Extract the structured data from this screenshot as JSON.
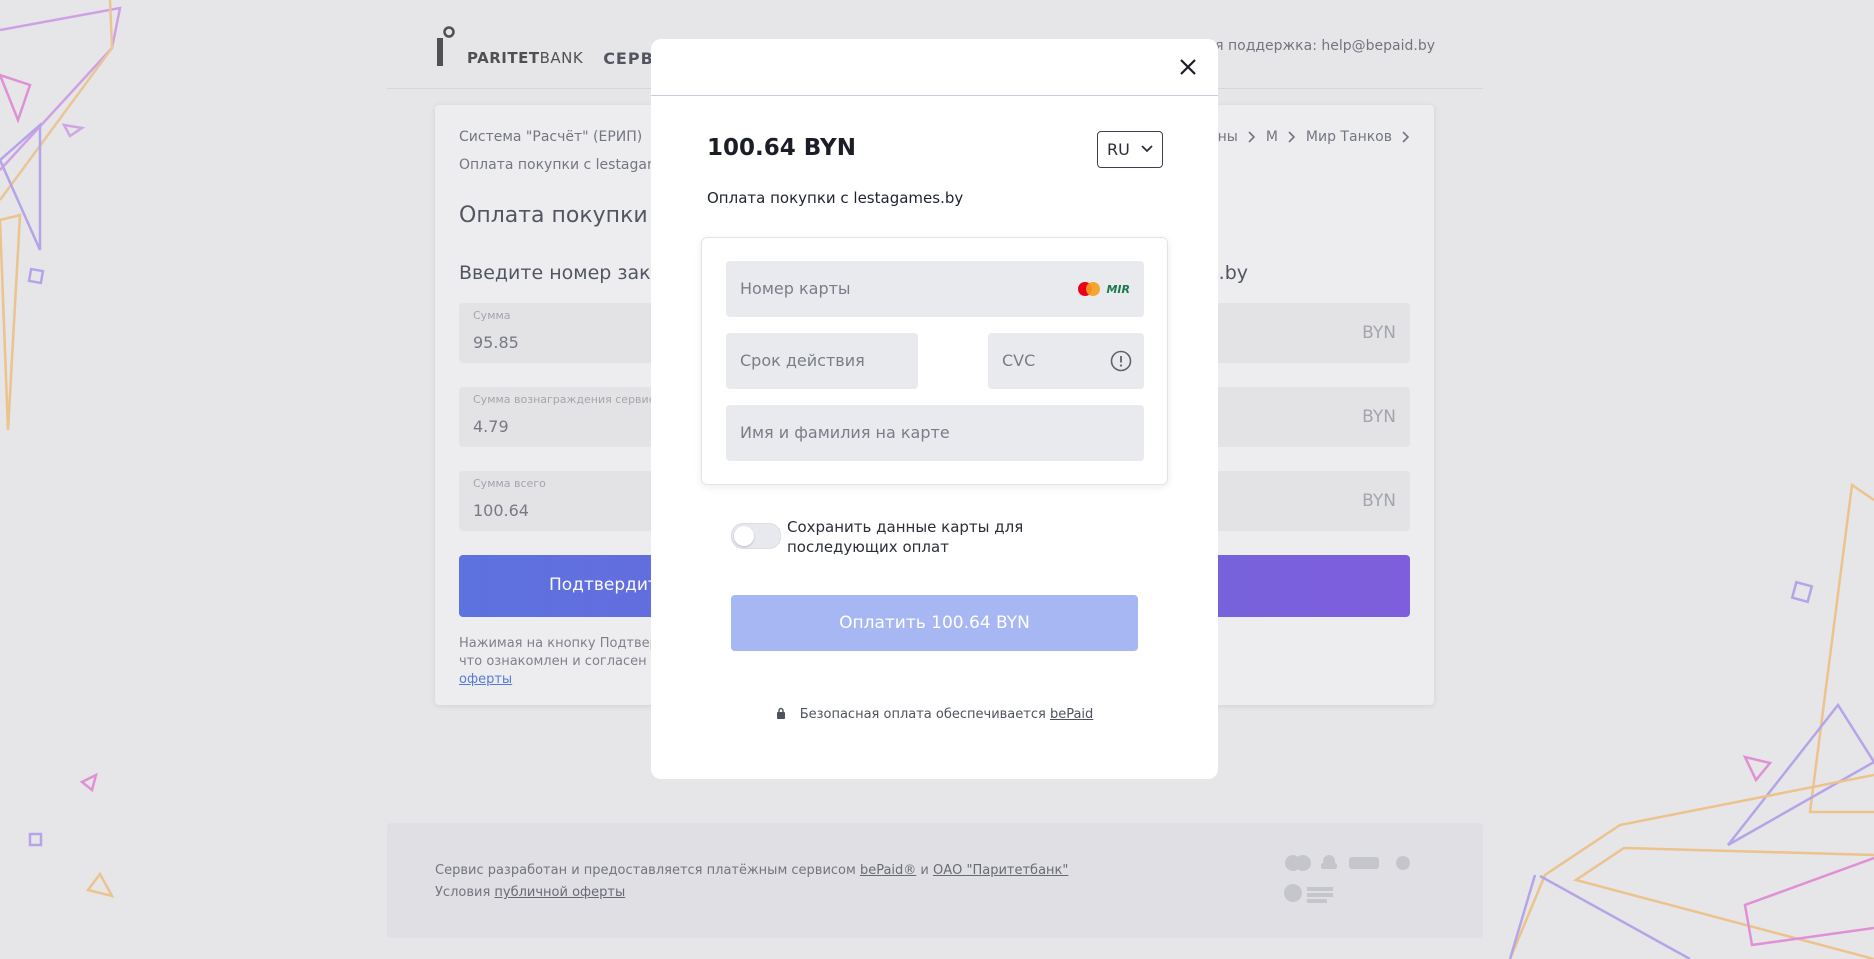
{
  "header": {
    "bank_name_bold": "PARITET",
    "bank_name_thin": "BANK",
    "service": "СЕРВИС С",
    "support": "чная поддержка: help@bepaid.by"
  },
  "breadcrumbs": {
    "left": "Система \"Расчёт\" (ЕРИП)",
    "right": [
      "ены",
      "М",
      "Мир Танков"
    ],
    "second_line": "Оплата покупки с lestagames."
  },
  "page": {
    "title": "Оплата покупки с",
    "subtitle_left": "Введите номер заказ",
    "subtitle_right": "s.by",
    "fields": [
      {
        "label": "Сумма",
        "value": "95.85",
        "currency": "BYN"
      },
      {
        "label": "Сумма вознаграждения сервиса",
        "value": "4.79",
        "currency": "BYN"
      },
      {
        "label": "Сумма всего",
        "value": "100.64",
        "currency": "BYN"
      }
    ],
    "confirm_label": "Подтвердит",
    "terms_line1": "Нажимая на кнопку Подтверд",
    "terms_line2": "что ознакомлен и согласен с",
    "terms_link": "оферты"
  },
  "footer": {
    "line1_text": "Сервис разработан и предоставляется платёжным сервисом ",
    "line1_link1": "bePaid®",
    "line1_and": " и ",
    "line1_link2": "ОАО \"Паритетбанк\"",
    "line2_text": "Условия ",
    "line2_link": "публичной оферты"
  },
  "modal": {
    "amount": "100.64 BYN",
    "language": "RU",
    "description": "Оплата покупки с lestagames.by",
    "card_number_placeholder": "Номер карты",
    "expiry_placeholder": "Срок действия",
    "cvc_placeholder": "CVC",
    "holder_placeholder": "Имя и фамилия на карте",
    "brand_mir": "MIR",
    "save_card_label": "Сохранить данные карты для последующих оплат",
    "save_card_enabled": false,
    "pay_button": "Оплатить 100.64 BYN",
    "secure_text": "Безопасная оплата обеспечивается ",
    "secure_link": "bePaid"
  },
  "colors": {
    "accent": "#2d4ad9",
    "pay_button_disabled": "#a7b7f3",
    "background": "#e4e4e6"
  }
}
